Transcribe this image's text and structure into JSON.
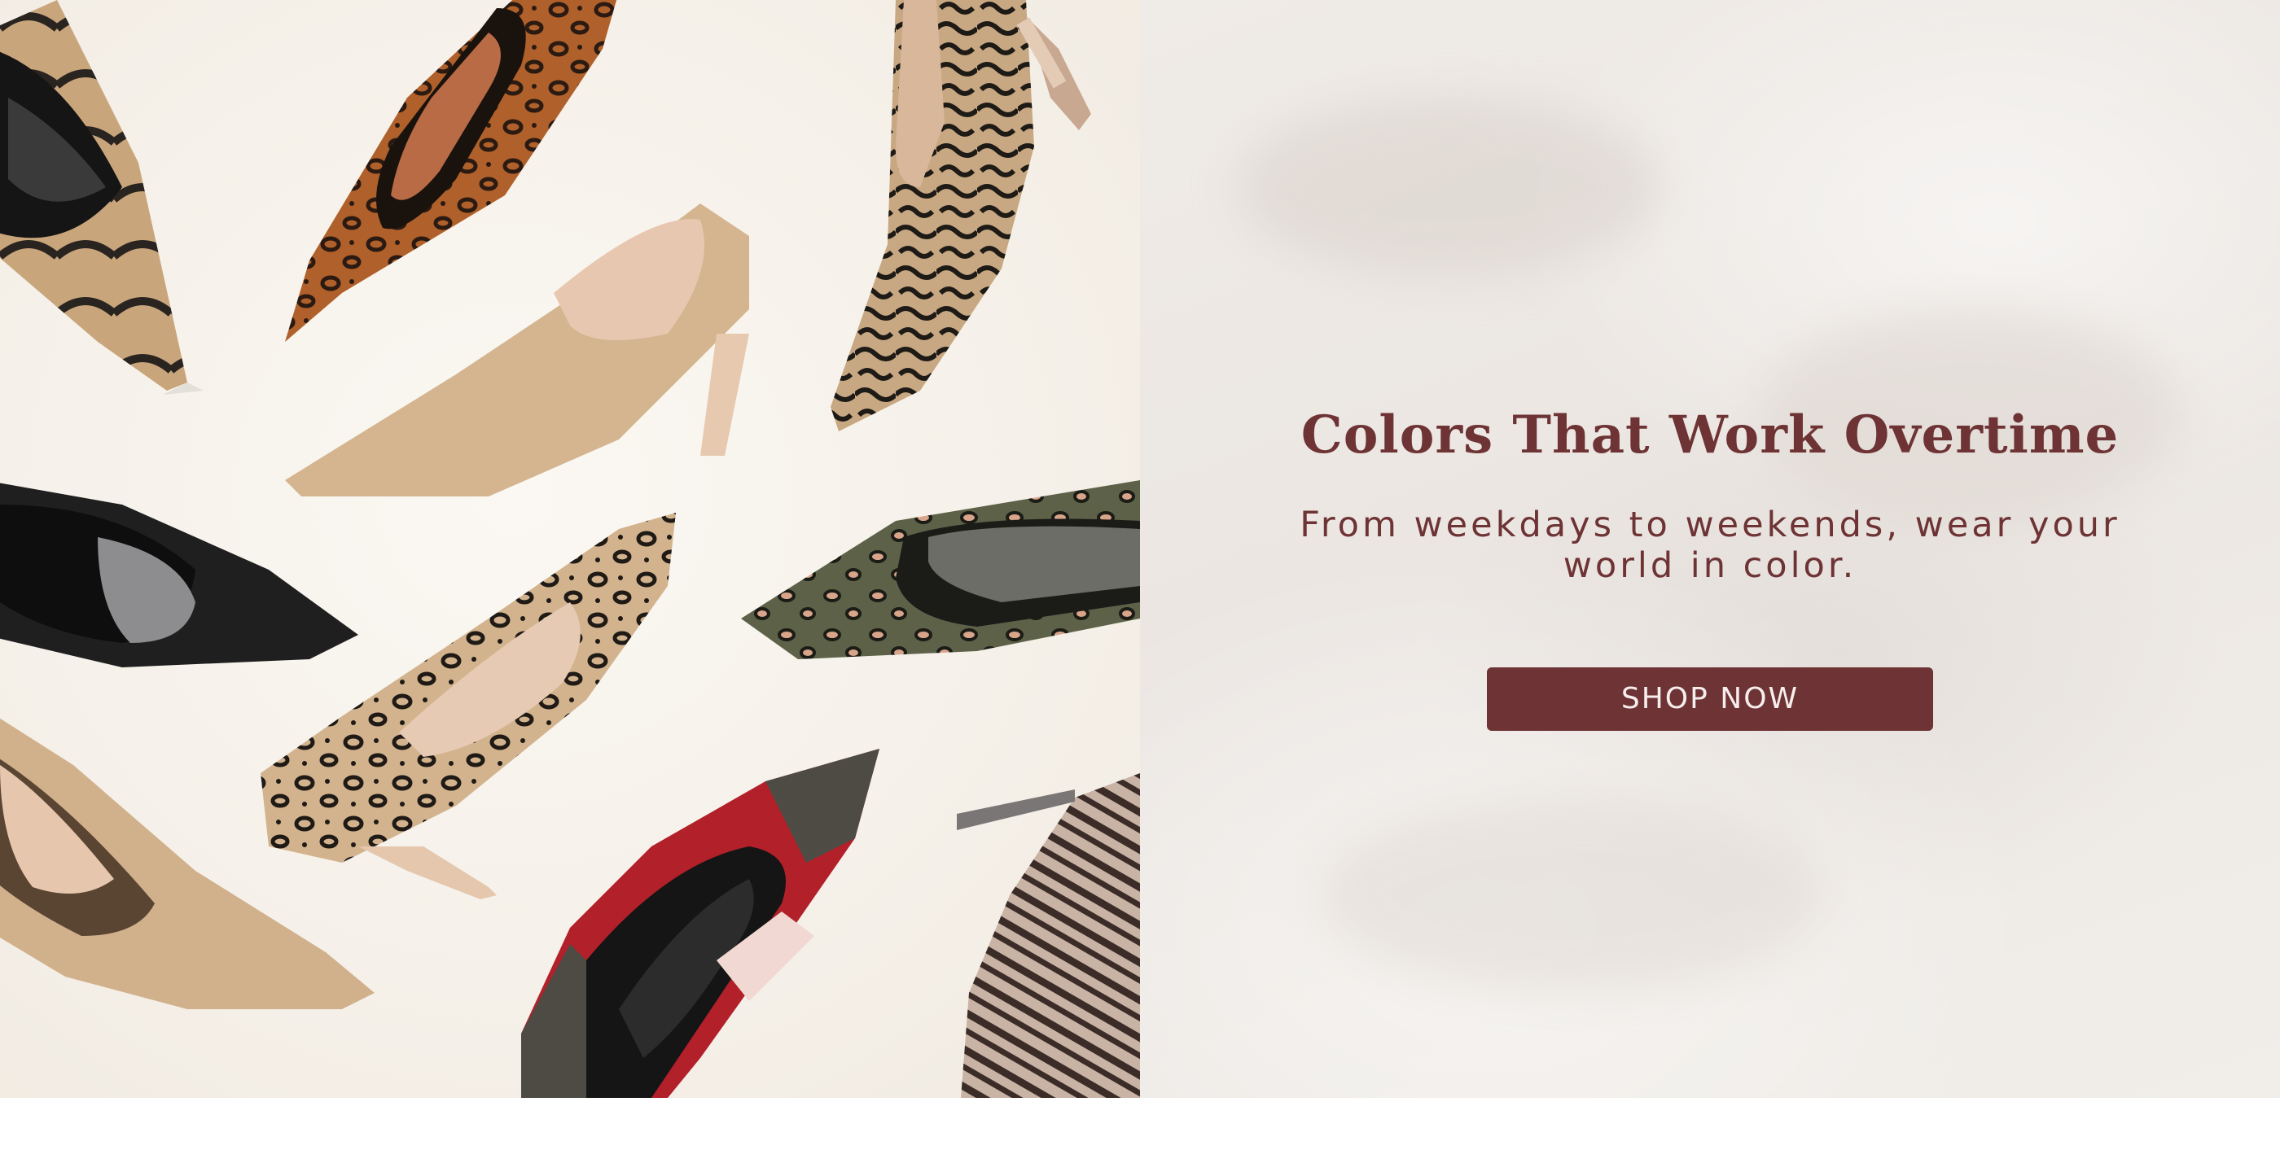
{
  "hero": {
    "title": "Colors That Work Overtime",
    "subtitle": "From weekdays to weekends, wear your world in color.",
    "cta_label": "SHOP NOW"
  },
  "photo": {
    "subject": "flat-lay of knit pointed-toe pumps",
    "shoes": [
      {
        "name": "black-tan-striped-pump",
        "upper_color": "#c9a57c",
        "pattern_color": "#2a2420"
      },
      {
        "name": "orange-leopard-pump",
        "upper_color": "#b0602a",
        "pattern_color": "#2a1a12"
      },
      {
        "name": "black-tan-leopard-pump-top",
        "upper_color": "#c8a882",
        "pattern_color": "#1e1a16"
      },
      {
        "name": "nude-pump",
        "upper_color": "#d4b590",
        "pattern_color": "#d4b590"
      },
      {
        "name": "black-pump",
        "upper_color": "#1f1f1f",
        "pattern_color": "#1f1f1f"
      },
      {
        "name": "olive-leopard-pump",
        "upper_color": "#5c6148",
        "pattern_color": "#d8a48a"
      },
      {
        "name": "tan-leopard-pump",
        "upper_color": "#d2b38d",
        "pattern_color": "#1f1a15"
      },
      {
        "name": "nude-pump-bottom",
        "upper_color": "#d1b18c",
        "pattern_color": "#d1b18c"
      },
      {
        "name": "red-colorblock-pump",
        "upper_color": "#b2202a",
        "pattern_color": "#4d4b44"
      },
      {
        "name": "zebra-pump",
        "upper_color": "#c9b3a5",
        "pattern_color": "#3c2c28"
      }
    ],
    "background_color": "#f5f0ea"
  },
  "colors": {
    "accent": "#6e3334",
    "panel_background": "#ece8e4"
  }
}
